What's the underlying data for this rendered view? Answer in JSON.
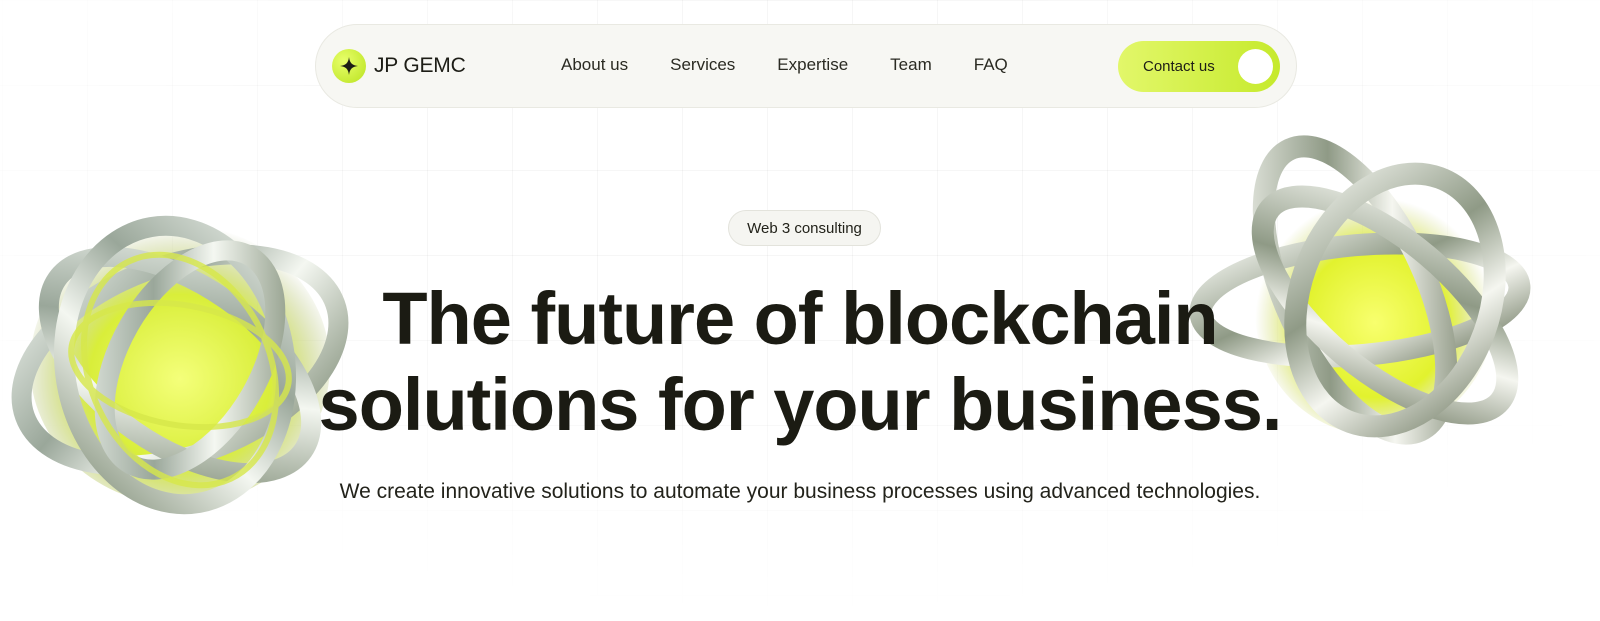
{
  "brand": {
    "name": "JP GEMC",
    "icon": "sparkle-icon",
    "accent": "#c9ec2e"
  },
  "nav": {
    "links": [
      "About us",
      "Services",
      "Expertise",
      "Team",
      "FAQ"
    ],
    "contact_label": "Contact us"
  },
  "hero": {
    "badge": "Web 3 consulting",
    "headline_line1": "The future of blockchain",
    "headline_line2": "solutions for your business.",
    "subtext": "We create innovative solutions to automate your business processes using advanced technologies."
  },
  "decor": {
    "left_image": "chrome-knot-image",
    "right_image": "chrome-knot-image"
  }
}
